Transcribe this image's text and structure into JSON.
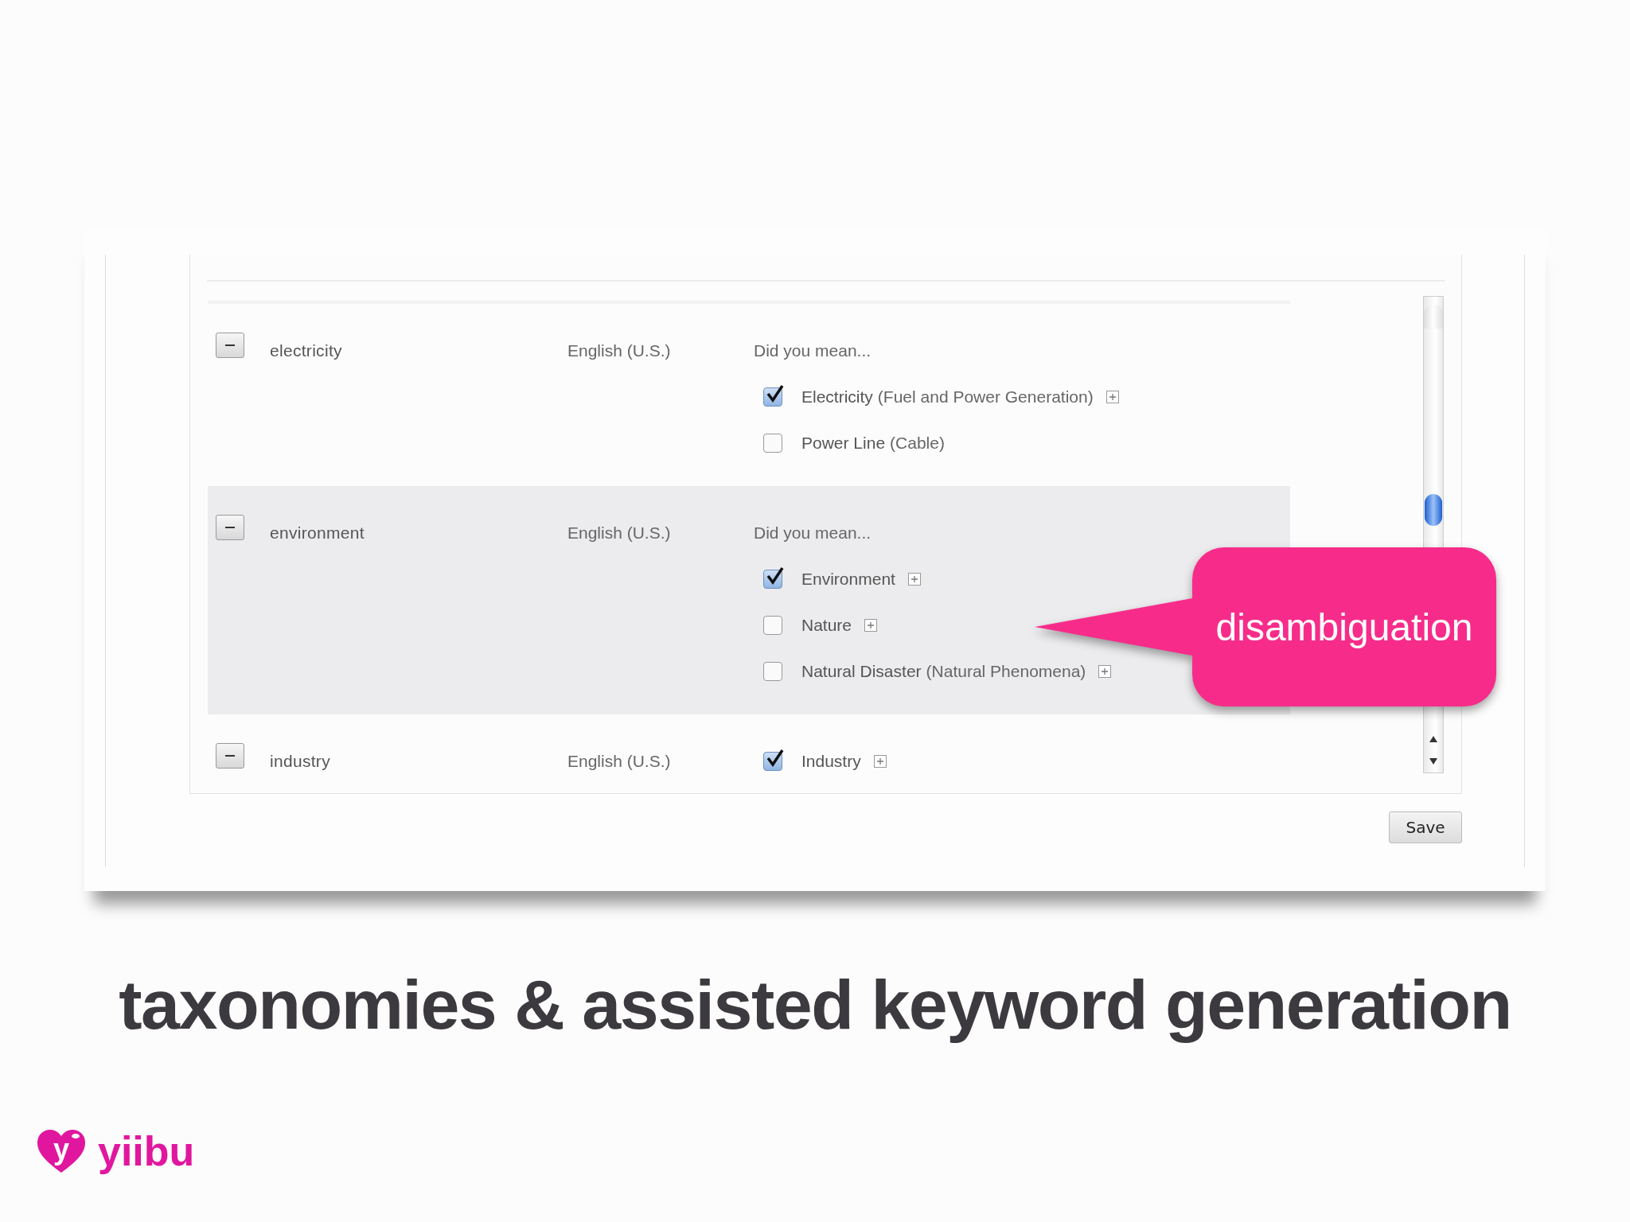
{
  "table": {
    "rows": [
      {
        "term": "electricity",
        "language": "English (U.S.)",
        "prompt": "Did you mean...",
        "highlighted": false,
        "suggestions": [
          {
            "label": "Electricity",
            "detail": "(Fuel and Power Generation)",
            "checked": true,
            "expandable": true
          },
          {
            "label": "Power Line",
            "detail": "(Cable)",
            "checked": false,
            "expandable": false
          }
        ]
      },
      {
        "term": "environment",
        "language": "English (U.S.)",
        "prompt": "Did you mean...",
        "highlighted": true,
        "suggestions": [
          {
            "label": "Environment",
            "checked": true,
            "expandable": true
          },
          {
            "label": "Nature",
            "checked": false,
            "expandable": true
          },
          {
            "label": "Natural Disaster",
            "detail": "(Natural Phenomena)",
            "checked": false,
            "expandable": true
          }
        ]
      },
      {
        "term": "industry",
        "language": "English (U.S.)",
        "highlighted": false,
        "suggestions": [
          {
            "label": "Industry",
            "checked": true,
            "expandable": true
          }
        ]
      }
    ]
  },
  "save_button": "Save",
  "callout": "disambiguation",
  "title": "taxonomies & assisted keyword generation",
  "logo": {
    "mark": "y",
    "name": "yiibu"
  }
}
